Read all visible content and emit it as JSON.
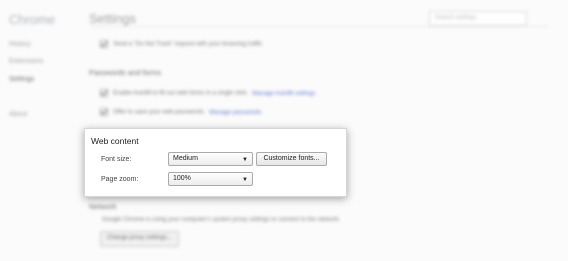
{
  "app": {
    "title": "Chrome"
  },
  "sidebar": {
    "items": [
      "History",
      "Extensions",
      "Settings",
      "About"
    ]
  },
  "header": {
    "title": "Settings",
    "search_placeholder": "Search settings"
  },
  "privacy": {
    "dnt_label": "Send a \"Do Not Track\" request with your browsing traffic"
  },
  "passwords": {
    "heading": "Passwords and forms",
    "autofill_label": "Enable Autofill to fill out web forms in a single click.",
    "autofill_link": "Manage Autofill settings",
    "save_label": "Offer to save your web passwords.",
    "save_link": "Manage passwords"
  },
  "web_content": {
    "heading": "Web content",
    "font_size_label": "Font size:",
    "font_size_value": "Medium",
    "customize_fonts_label": "Customize fonts...",
    "page_zoom_label": "Page zoom:",
    "page_zoom_value": "100%"
  },
  "network": {
    "heading": "Network",
    "description": "Google Chrome is using your computer's system proxy settings to connect to the network.",
    "proxy_button": "Change proxy settings..."
  }
}
